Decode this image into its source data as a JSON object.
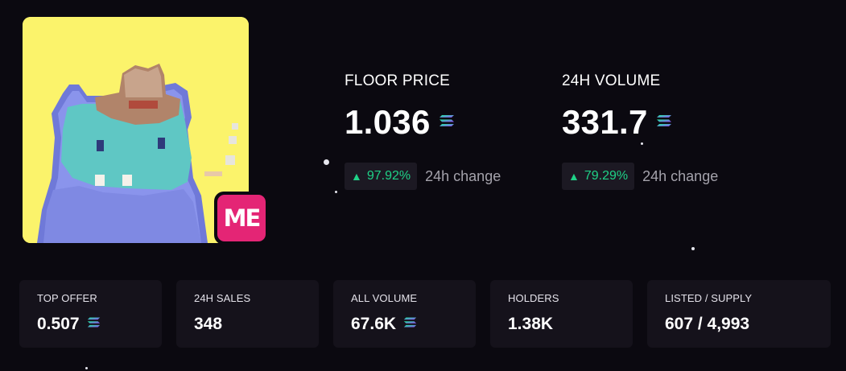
{
  "collection": {
    "image_name": "pixel-creature-with-cowboy-hat",
    "marketplace_badge": "ME"
  },
  "floor_price": {
    "label": "FLOOR PRICE",
    "value": "1.036",
    "currency_icon": "solana-icon",
    "change": "97.92%",
    "change_direction": "up",
    "change_caption": "24h change"
  },
  "volume_24h": {
    "label": "24H VOLUME",
    "value": "331.7",
    "currency_icon": "solana-icon",
    "change": "79.29%",
    "change_direction": "up",
    "change_caption": "24h change"
  },
  "cards": [
    {
      "label": "TOP OFFER",
      "value": "0.507",
      "has_currency_icon": true
    },
    {
      "label": "24H SALES",
      "value": "348",
      "has_currency_icon": false
    },
    {
      "label": "ALL VOLUME",
      "value": "67.6K",
      "has_currency_icon": true
    },
    {
      "label": "HOLDERS",
      "value": "1.38K",
      "has_currency_icon": false
    },
    {
      "label": "LISTED / SUPPLY",
      "value": "607 / 4,993",
      "has_currency_icon": false
    }
  ],
  "colors": {
    "background": "#0b0910",
    "card_background": "#15121b",
    "positive_change": "#1fd187",
    "badge": "#e42575",
    "image_background": "#fbf36b"
  }
}
